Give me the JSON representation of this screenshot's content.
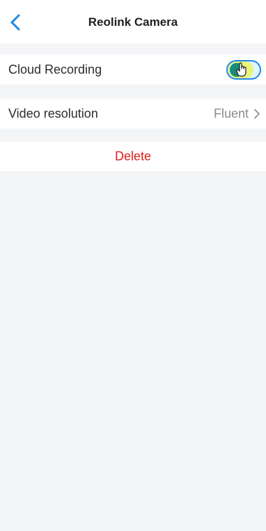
{
  "header": {
    "title": "Reolink Camera",
    "back_icon": "chevron-left-icon"
  },
  "settings": {
    "cloud_recording": {
      "label": "Cloud Recording",
      "toggle_on": true
    },
    "video_resolution": {
      "label": "Video resolution",
      "value": "Fluent"
    },
    "delete_label": "Delete"
  },
  "colors": {
    "accent": "#1e88e5",
    "delete": "#e21b1b",
    "background": "#f4f5f7"
  }
}
